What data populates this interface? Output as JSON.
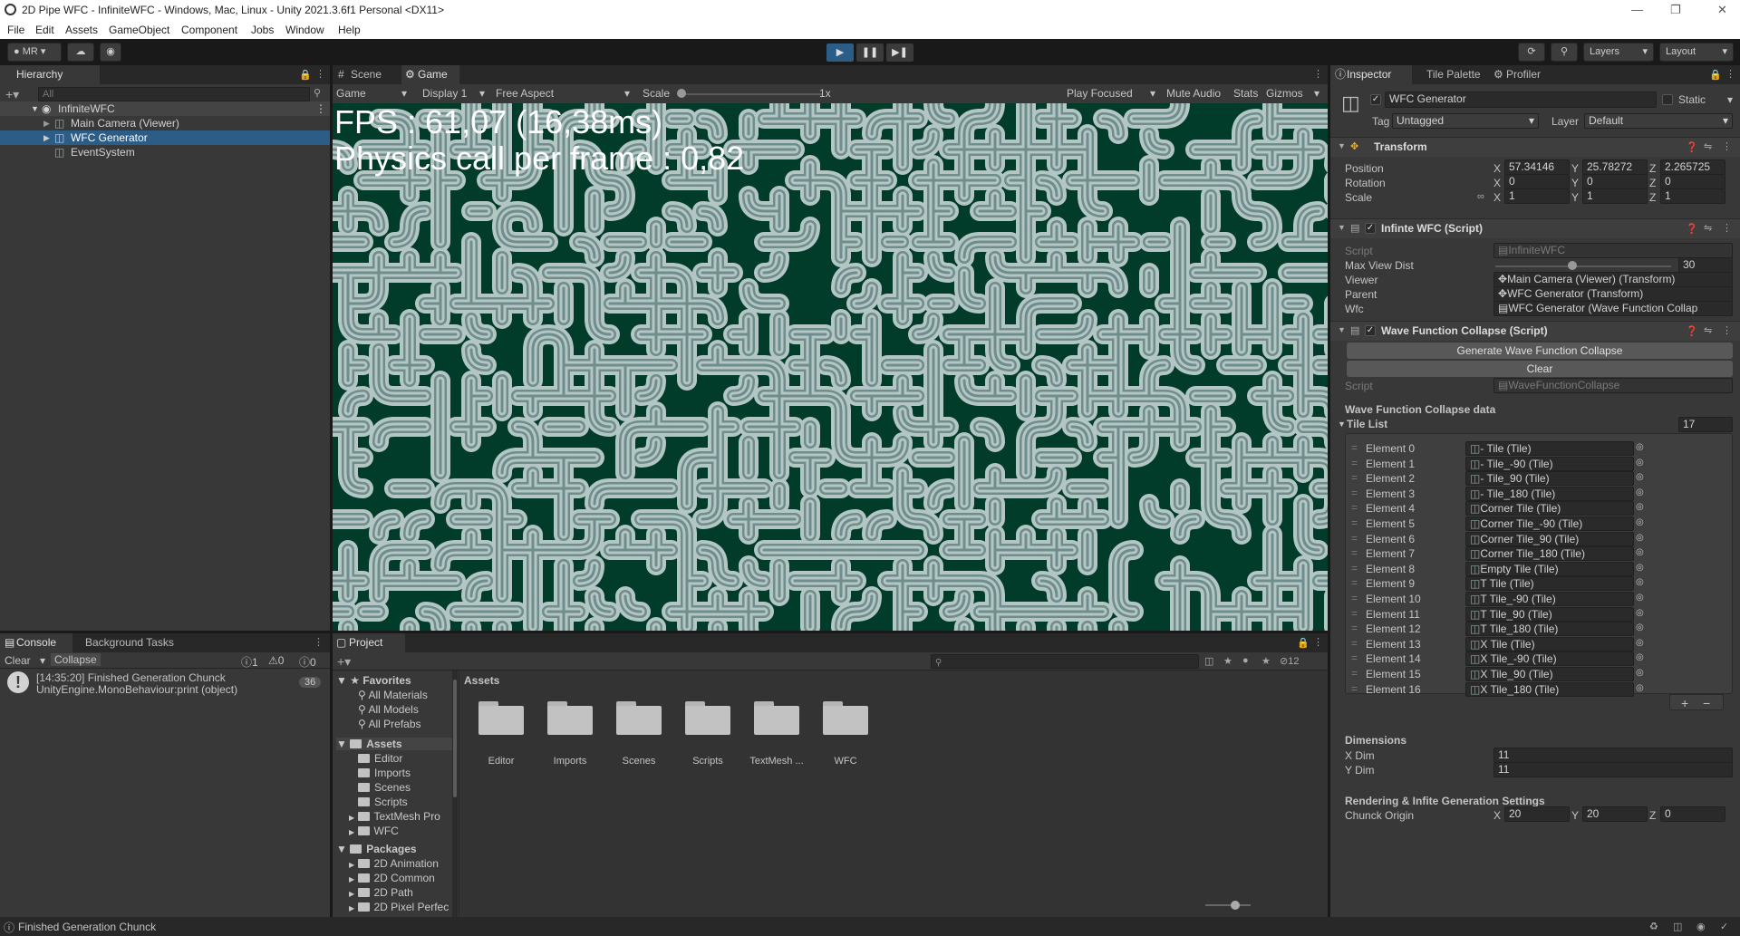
{
  "window": {
    "title": "2D Pipe WFC - InfiniteWFC - Windows, Mac, Linux - Unity 2021.3.6f1 Personal <DX11>"
  },
  "menu": [
    "File",
    "Edit",
    "Assets",
    "GameObject",
    "Component",
    "Jobs",
    "Window",
    "Help"
  ],
  "toolbar": {
    "account": "MR",
    "layers": "Layers",
    "layout": "Layout"
  },
  "hierarchy": {
    "tab": "Hierarchy",
    "search_placeholder": "All",
    "scene": "InfiniteWFC",
    "items": [
      "Main Camera (Viewer)",
      "WFC Generator",
      "EventSystem"
    ]
  },
  "view": {
    "tabs": [
      "Scene",
      "Game"
    ],
    "game_dropdown": "Game",
    "display": "Display 1",
    "aspect": "Free Aspect",
    "scale_label": "Scale",
    "scale_value": "1x",
    "play_focused": "Play Focused",
    "mute": "Mute Audio",
    "stats": "Stats",
    "gizmos": "Gizmos",
    "fps": "FPS : 61,07 (16,38ms)",
    "physics": "Physics call per frame : 0,82"
  },
  "console": {
    "tabs": [
      "Console",
      "Background Tasks"
    ],
    "clear": "Clear",
    "collapse": "Collapse",
    "count_info": "1",
    "count_warn": "0",
    "count_err": "0",
    "msg1": "[14:35:20] Finished Generation Chunck",
    "msg2": "UnityEngine.MonoBehaviour:print (object)",
    "msg_count": "36"
  },
  "project": {
    "tab": "Project",
    "hidden_count": "12",
    "assets_title": "Assets",
    "favorites": "Favorites",
    "fav_items": [
      "All Materials",
      "All Models",
      "All Prefabs"
    ],
    "assets": "Assets",
    "asset_items": [
      "Editor",
      "Imports",
      "Scenes",
      "Scripts",
      "TextMesh Pro",
      "WFC"
    ],
    "packages": "Packages",
    "package_items": [
      "2D Animation",
      "2D Common",
      "2D Path",
      "2D Pixel Perfec"
    ],
    "folders": [
      "Editor",
      "Imports",
      "Scenes",
      "Scripts",
      "TextMesh ...",
      "WFC"
    ]
  },
  "inspector": {
    "tabs": [
      "Inspector",
      "Tile Palette",
      "Profiler"
    ],
    "object_name": "WFC Generator",
    "static": "Static",
    "tag_label": "Tag",
    "tag": "Untagged",
    "layer_label": "Layer",
    "layer": "Default",
    "transform": {
      "title": "Transform",
      "position": "Position",
      "rotation": "Rotation",
      "scale": "Scale",
      "pos": [
        "57.34146",
        "25.78272",
        "2.265725"
      ],
      "rot": [
        "0",
        "0",
        "0"
      ],
      "scl": [
        "1",
        "1",
        "1"
      ]
    },
    "infinite": {
      "title": "Infinte WFC (Script)",
      "script_label": "Script",
      "script": "InfiniteWFC",
      "maxview_label": "Max View Dist",
      "maxview": "30",
      "viewer_label": "Viewer",
      "viewer": "Main Camera (Viewer) (Transform)",
      "parent_label": "Parent",
      "parent": "WFC Generator (Transform)",
      "wfc_label": "Wfc",
      "wfc": "WFC Generator (Wave Function Collap"
    },
    "wfc": {
      "title": "Wave Function Collapse (Script)",
      "generate": "Generate Wave Function Collapse",
      "clear": "Clear",
      "script_label": "Script",
      "script": "WaveFunctionCollapse",
      "data_label": "Wave Function Collapse data",
      "tilelist_label": "Tile List",
      "tilelist_count": "17",
      "elements": [
        {
          "n": "Element 0",
          "v": "- Tile (Tile)"
        },
        {
          "n": "Element 1",
          "v": "- Tile_-90 (Tile)"
        },
        {
          "n": "Element 2",
          "v": "- Tile_90 (Tile)"
        },
        {
          "n": "Element 3",
          "v": "- Tile_180 (Tile)"
        },
        {
          "n": "Element 4",
          "v": "Corner Tile (Tile)"
        },
        {
          "n": "Element 5",
          "v": "Corner Tile_-90 (Tile)"
        },
        {
          "n": "Element 6",
          "v": "Corner Tile_90 (Tile)"
        },
        {
          "n": "Element 7",
          "v": "Corner Tile_180 (Tile)"
        },
        {
          "n": "Element 8",
          "v": "Empty Tile (Tile)"
        },
        {
          "n": "Element 9",
          "v": "T Tile (Tile)"
        },
        {
          "n": "Element 10",
          "v": "T Tile_-90 (Tile)"
        },
        {
          "n": "Element 11",
          "v": "T Tile_90 (Tile)"
        },
        {
          "n": "Element 12",
          "v": "T Tile_180 (Tile)"
        },
        {
          "n": "Element 13",
          "v": "X Tile (Tile)"
        },
        {
          "n": "Element 14",
          "v": "X Tile_-90 (Tile)"
        },
        {
          "n": "Element 15",
          "v": "X Tile_90 (Tile)"
        },
        {
          "n": "Element 16",
          "v": "X Tile_180 (Tile)"
        }
      ],
      "dimensions_label": "Dimensions",
      "xdim_label": "X Dim",
      "xdim": "11",
      "ydim_label": "Y Dim",
      "ydim": "11",
      "render_label": "Rendering & Infite Generation Settings",
      "chunk_label": "Chunck Origin",
      "chunk": [
        "20",
        "20",
        "0"
      ]
    }
  },
  "status": {
    "text": "Finished Generation Chunck"
  },
  "colors": {
    "accent": "#2c5d87",
    "maze_bg": "#013b2a",
    "pipe_outer": "#b3c6c4",
    "pipe_mid": "#6f8d8d"
  }
}
